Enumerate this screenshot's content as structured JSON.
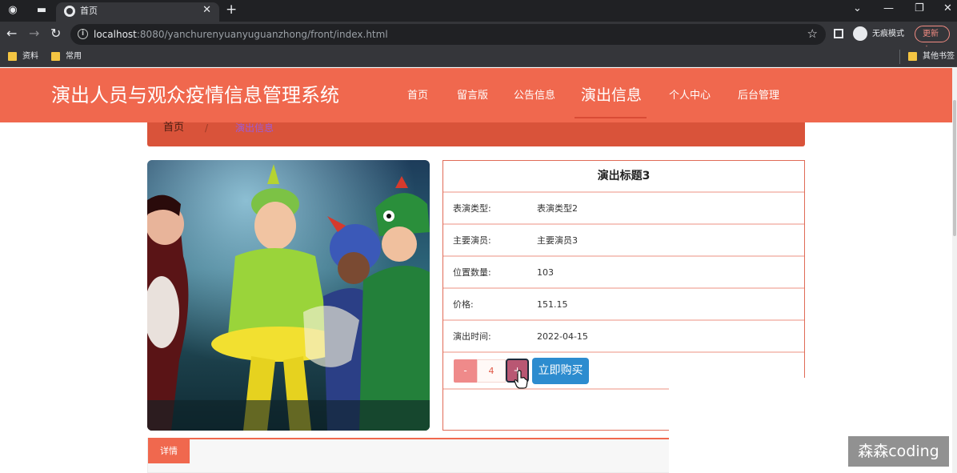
{
  "browser": {
    "active_tab_title": "首页",
    "url_host": "localhost",
    "url_rest": ":8080/yanchurenyuanyuguanzhong/front/index.html",
    "incognito_label": "无痕模式",
    "update_label": "更新",
    "bookmarks": [
      "资料",
      "常用"
    ],
    "other_bookmarks": "其他书签"
  },
  "header": {
    "site_title": "演出人员与观众疫情信息管理系统",
    "nav": [
      {
        "label": "首页"
      },
      {
        "label": "留言版"
      },
      {
        "label": "公告信息"
      },
      {
        "label": "演出信息"
      },
      {
        "label": "个人中心"
      },
      {
        "label": "后台管理"
      }
    ],
    "active_nav": "演出信息"
  },
  "breadcrumb": {
    "home": "首页",
    "separator": "/",
    "current": "演出信息"
  },
  "detail": {
    "title": "演出标题3",
    "fields": [
      {
        "label": "表演类型:",
        "value": "表演类型2"
      },
      {
        "label": "主要演员:",
        "value": "主要演员3"
      },
      {
        "label": "位置数量:",
        "value": "103"
      },
      {
        "label": "价格:",
        "value": "151.15"
      },
      {
        "label": "演出时间:",
        "value": "2022-04-15"
      }
    ],
    "minus_label": "-",
    "quantity": "4",
    "plus_label": "+",
    "buy_label": "立即购买"
  },
  "tabs": {
    "detail_tab": "详情"
  },
  "watermark": "森森coding",
  "colors": {
    "brand": "#f0684e",
    "breadcrumb_bg": "#d9533a",
    "buy_button": "#2d8ccf"
  }
}
